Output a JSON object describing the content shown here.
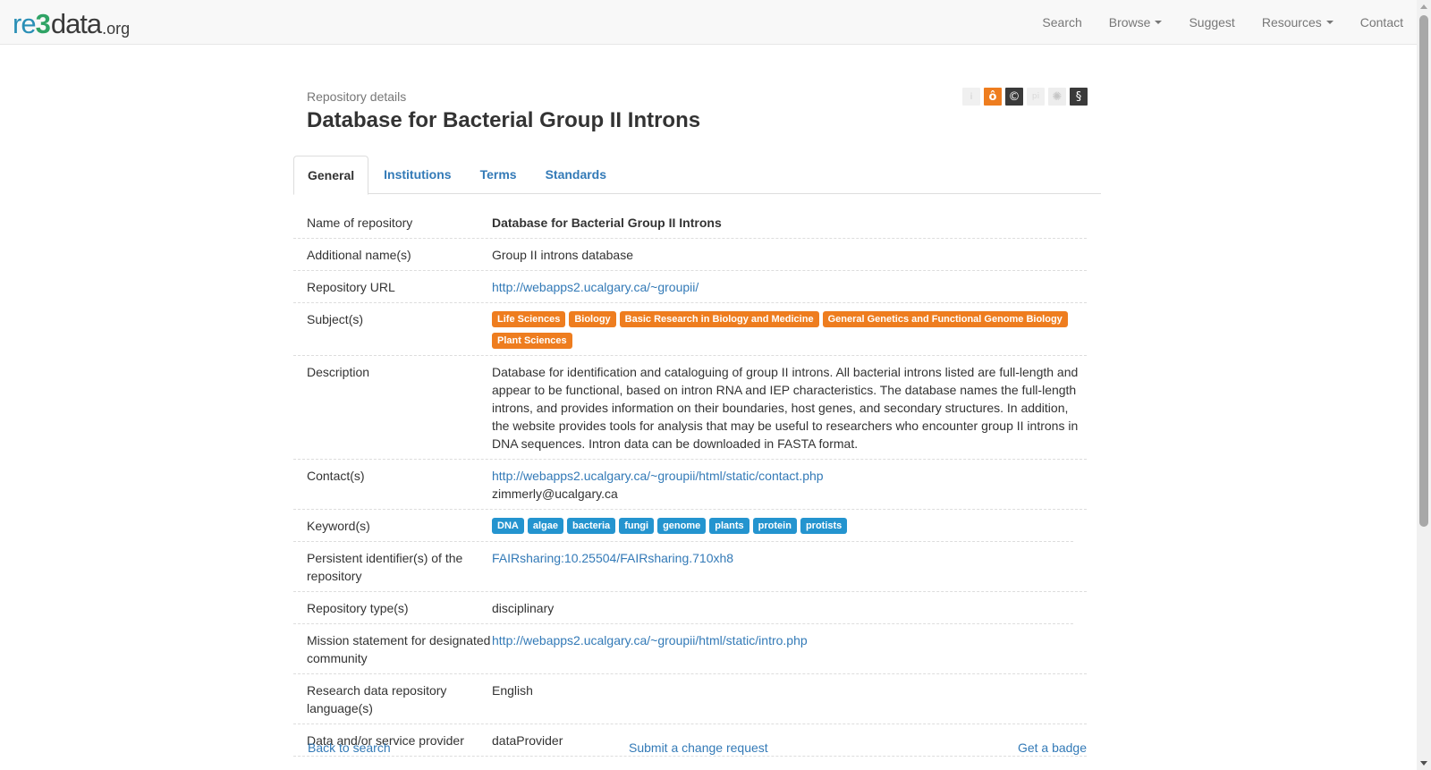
{
  "navbar": {
    "brand": {
      "re": "re",
      "three": "3",
      "data": "data",
      "org": ".org"
    },
    "items": [
      {
        "label": "Search",
        "dropdown": false
      },
      {
        "label": "Browse",
        "dropdown": true
      },
      {
        "label": "Suggest",
        "dropdown": false
      },
      {
        "label": "Resources",
        "dropdown": true
      },
      {
        "label": "Contact",
        "dropdown": false
      }
    ]
  },
  "header": {
    "subtitle": "Repository details",
    "title": "Database for Bacterial Group II Introns",
    "badges": [
      {
        "icon": "info-icon",
        "glyph": "i"
      },
      {
        "icon": "open-access-icon",
        "glyph": "ô"
      },
      {
        "icon": "copyright-icon",
        "glyph": "©"
      },
      {
        "icon": "persistent-identifier-icon",
        "glyph": "pi"
      },
      {
        "icon": "certificate-icon",
        "glyph": "✺"
      },
      {
        "icon": "policy-icon",
        "glyph": "§"
      }
    ]
  },
  "tabs": [
    "General",
    "Institutions",
    "Terms",
    "Standards"
  ],
  "details": {
    "name_label": "Name of repository",
    "name_value": "Database for Bacterial Group II Introns",
    "additional_label": "Additional name(s)",
    "additional_value": "Group II introns database",
    "url_label": "Repository URL",
    "url_value": "http://webapps2.ucalgary.ca/~groupii/",
    "subjects_label": "Subject(s)",
    "subjects": [
      "Life Sciences",
      "Biology",
      "Basic Research in Biology and Medicine",
      "General Genetics and Functional Genome Biology",
      "Plant Sciences"
    ],
    "description_label": "Description",
    "description_value": "Database for identification and cataloguing of group II introns. All bacterial introns listed are full-length and appear to be functional, based on intron RNA and IEP characteristics. The database names the full-length introns, and provides information on their boundaries, host genes, and secondary structures. In addition, the website provides tools for analysis that may be useful to researchers who encounter group II introns in DNA sequences. Intron data can be downloaded in FASTA format.",
    "contacts_label": "Contact(s)",
    "contact_link": "http://webapps2.ucalgary.ca/~groupii/html/static/contact.php",
    "contact_email": "zimmerly@ucalgary.ca",
    "keywords_label": "Keyword(s)",
    "keywords": [
      "DNA",
      "algae",
      "bacteria",
      "fungi",
      "genome",
      "plants",
      "protein",
      "protists"
    ],
    "pid_label": "Persistent identifier(s) of the repository",
    "pid_value": "FAIRsharing:10.25504/FAIRsharing.710xh8",
    "type_label": "Repository type(s)",
    "type_value": "disciplinary",
    "mission_label": "Mission statement for designated community",
    "mission_value": "http://webapps2.ucalgary.ca/~groupii/html/static/intro.php",
    "language_label": "Research data repository language(s)",
    "language_value": "English",
    "provider_label": "Data and/or service provider",
    "provider_value": "dataProvider"
  },
  "footer": {
    "back": "Back to search",
    "change": "Submit a change request",
    "badge": "Get a badge"
  },
  "colors": {
    "subject_tag": "#ee7d1f",
    "keyword_tag": "#2494cf",
    "link": "#337ab7"
  }
}
